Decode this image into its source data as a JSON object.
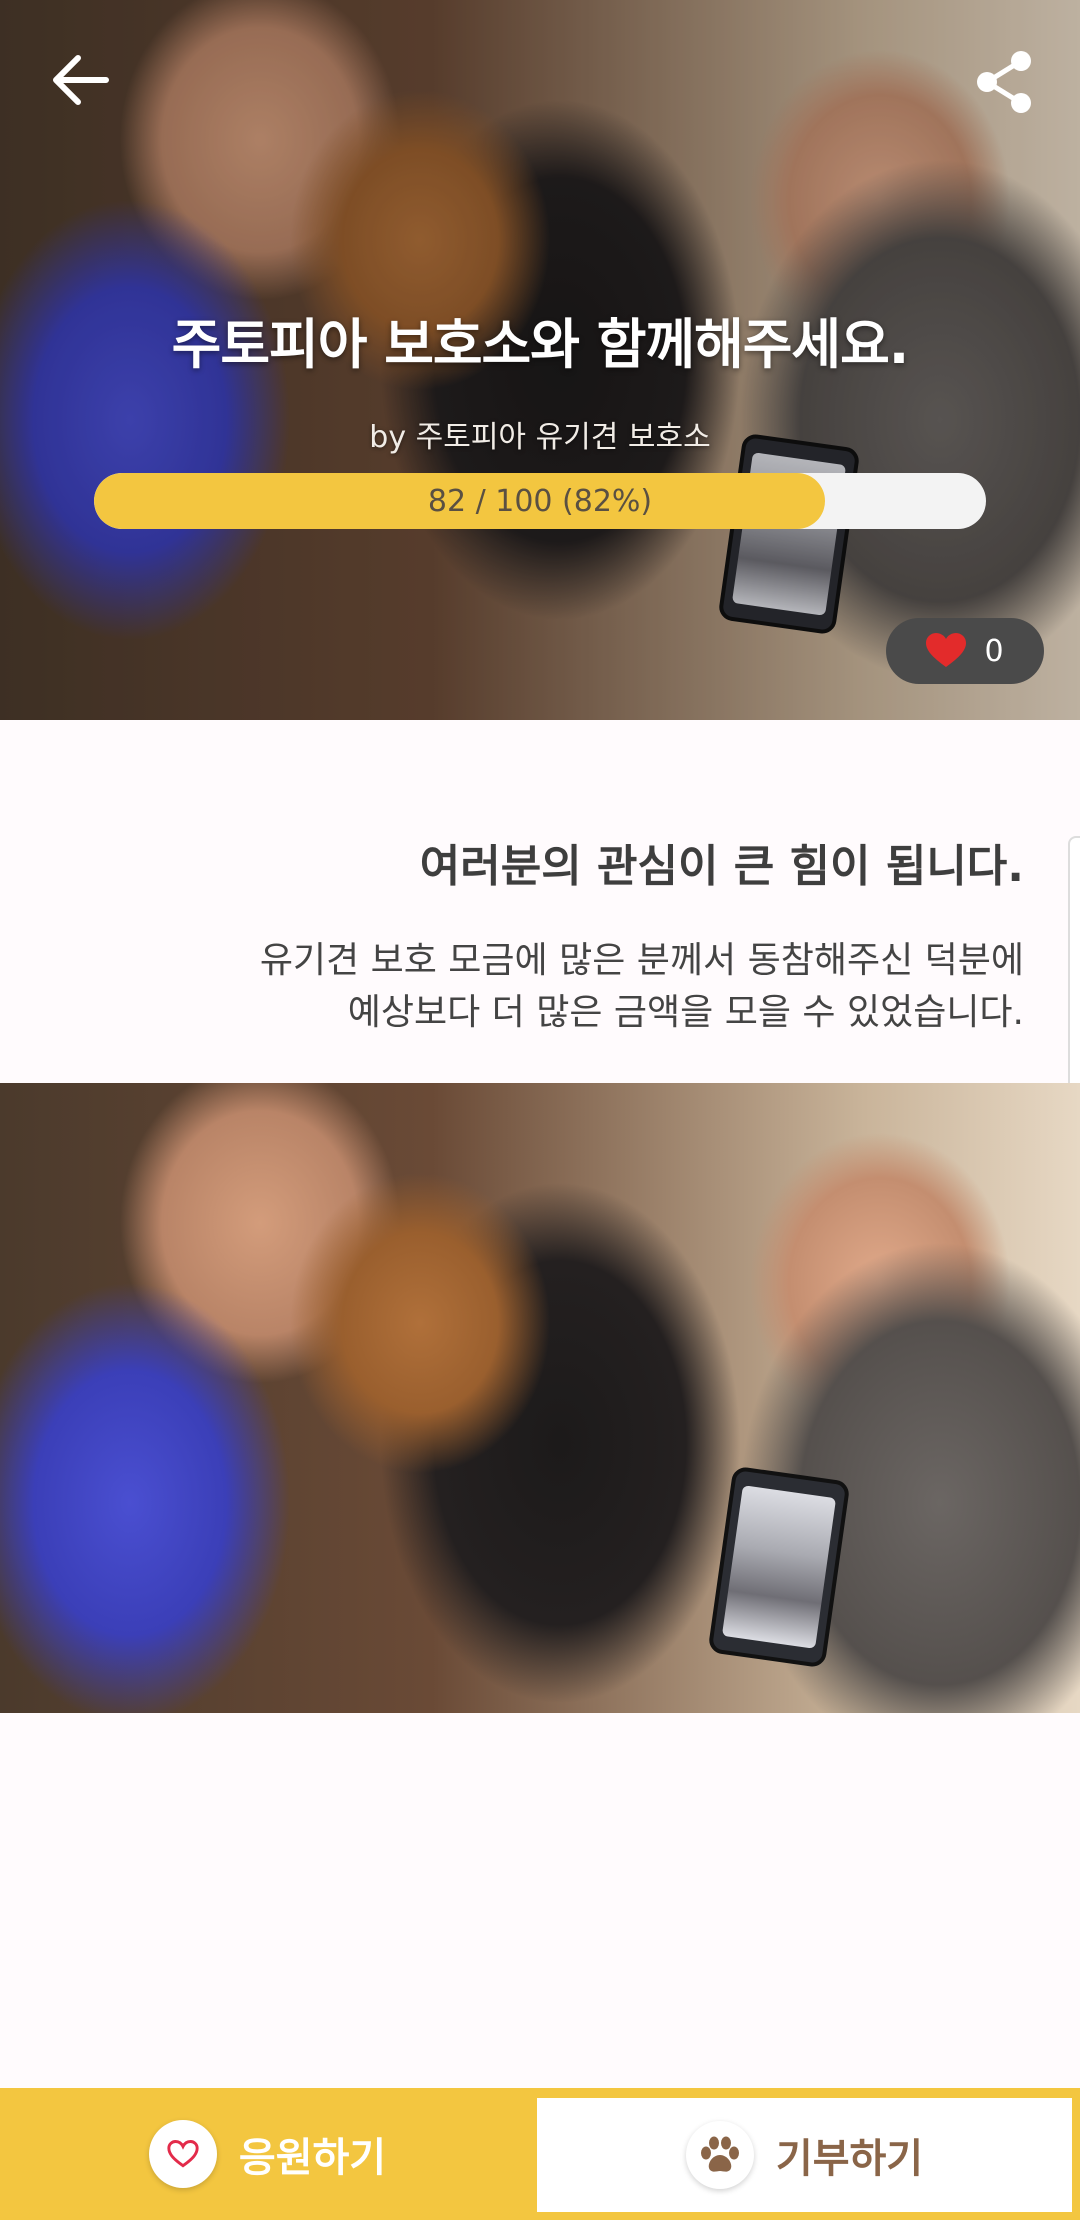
{
  "header": {
    "title": "주토피아 보호소와 함께해주세요.",
    "byline": "by 주토피아 유기견 보호소",
    "progress": {
      "text": "82 / 100 (82%)",
      "current": 82,
      "goal": 100,
      "percent": 82
    },
    "likes": "0"
  },
  "content": {
    "headline": "여러분의 관심이 큰 힘이 됩니다.",
    "body_line1": "유기견 보호 모금에 많은 분께서 동참해주신 덕분에",
    "body_line2": "예상보다 더 많은 금액을 모을 수 있었습니다."
  },
  "bottom_bar": {
    "support_label": "응원하기",
    "donate_label": "기부하기"
  },
  "colors": {
    "accent": "#f3c640",
    "heart": "#e32b2b",
    "paw": "#8a6548"
  },
  "icons": [
    "back-arrow-icon",
    "share-icon",
    "heart-icon",
    "paw-icon"
  ]
}
